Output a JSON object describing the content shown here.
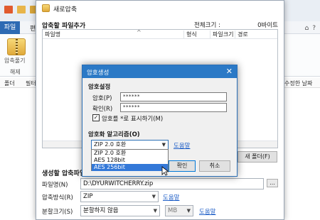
{
  "background_app": {
    "tab_file": "파일",
    "tab_second": "편",
    "compress_label": "압축풀기",
    "extract_label": "해제",
    "col_folder": "폴더",
    "col_filter": "필터",
    "col_modified": "수정한 날짜"
  },
  "window": {
    "title": "새로압축",
    "section_title": "압축할 파일추가",
    "total_size_label": "전체크기 :",
    "total_size_value": "0바이트",
    "columns": [
      "파일명",
      "형식",
      "파일크기",
      "경로"
    ],
    "new_folder_button": "새 폴더(F)",
    "group_title": "생성할 압축파일",
    "filename_label": "파일명(N)",
    "filename_value": "D:\\DYURWITCHERRY.zip",
    "browse_button": "...",
    "format_label": "압축방식(R)",
    "format_value": "ZIP",
    "format_help": "도움말",
    "split_label": "분할크기(S)",
    "split_value": "분할하지 않음",
    "split_unit": "MB",
    "split_help": "도움말"
  },
  "dialog": {
    "title": "암호생성",
    "close_glyph": "✕",
    "group_password": "암호설정",
    "password_label": "암호(P)",
    "password_value": "******",
    "confirm_label": "확인(R)",
    "confirm_value": "******",
    "show_password_label": "암호를 *로 표시하기(M)",
    "show_password_checked": true,
    "group_algorithm": "암호화 알고리즘(O)",
    "algorithm_selected": "ZIP 2.0 호환",
    "algorithm_help": "도움말",
    "algorithm_options": [
      "ZIP 2.0 호환",
      "AES 128bit",
      "AES 256bit"
    ],
    "algorithm_highlighted_index": 2,
    "ok_button": "확인",
    "cancel_button": "취소"
  },
  "colors": {
    "accent": "#2b79c6",
    "selection": "#3378d8",
    "link": "#1f5fc7"
  }
}
